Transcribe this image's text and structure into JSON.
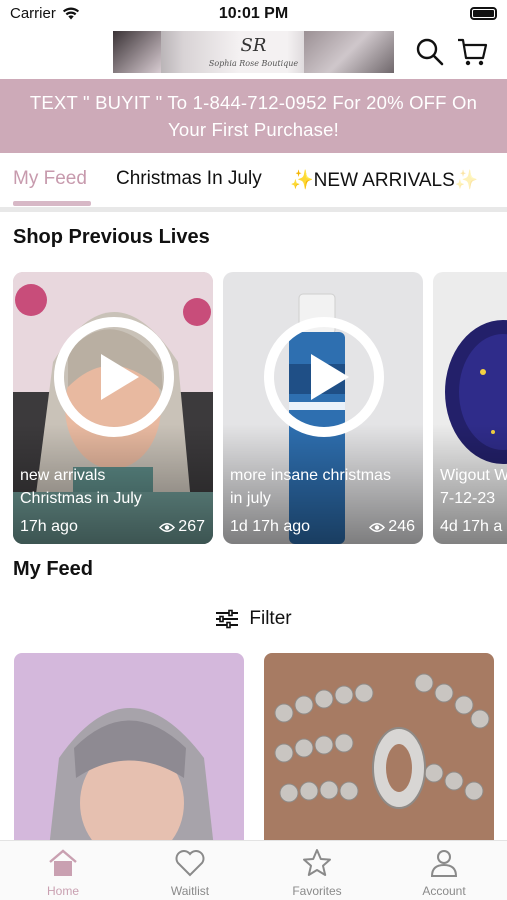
{
  "status_bar": {
    "carrier": "Carrier",
    "time": "10:01 PM"
  },
  "header": {
    "logo_monogram": "SR",
    "logo_subtitle": "Sophia Rose Boutique",
    "search_icon": "search-icon",
    "cart_icon": "cart-icon"
  },
  "promo": {
    "line1": "TEXT \" BUYIT \" To 1-844-712-0952 For 20% OFF On",
    "line2": "Your First Purchase!"
  },
  "tabs": [
    {
      "label": "My Feed",
      "active": true
    },
    {
      "label": "Christmas In July",
      "active": false
    },
    {
      "label": "NEW ARRIVALS",
      "active": false,
      "icon": "sparkles-icon"
    }
  ],
  "shop_previous_lives": {
    "title": "Shop Previous Lives",
    "items": [
      {
        "title_line1": "new arrivals",
        "title_line2": "Christmas in July",
        "age": "17h ago",
        "views": "267"
      },
      {
        "title_line1": "more insane christmas",
        "title_line2": "in july",
        "age": "1d 17h ago",
        "views": "246"
      },
      {
        "title_line1": "Wigout W",
        "title_line2": "7-12-23",
        "age": "4d 17h a",
        "views": ""
      }
    ]
  },
  "my_feed": {
    "title": "My Feed",
    "filter_label": "Filter"
  },
  "bottom_nav": [
    {
      "label": "Home",
      "icon": "home-icon",
      "active": true
    },
    {
      "label": "Waitlist",
      "icon": "heart-icon",
      "active": false
    },
    {
      "label": "Favorites",
      "icon": "star-icon",
      "active": false
    },
    {
      "label": "Account",
      "icon": "person-icon",
      "active": false
    }
  ],
  "colors": {
    "brand_pink": "#cdaab8",
    "tab_active": "#c79aad",
    "nav_active": "#c9a0b1"
  }
}
